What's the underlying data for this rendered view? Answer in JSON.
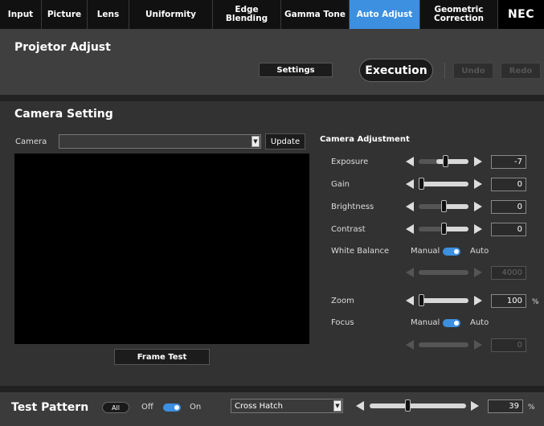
{
  "tabs": [
    {
      "label": "Input"
    },
    {
      "label": "Picture"
    },
    {
      "label": "Lens"
    },
    {
      "label": "Uniformity"
    },
    {
      "label": "Edge Blending"
    },
    {
      "label": "Gamma Tone"
    },
    {
      "label": "Auto Adjust"
    },
    {
      "label": "Geometric Correction"
    },
    {
      "label": "NEC"
    }
  ],
  "active_tab": "Auto Adjust",
  "projector": {
    "title": "Projetor Adjust",
    "settings_label": "Settings",
    "execution_label": "Execution",
    "undo_label": "Undo",
    "redo_label": "Redo"
  },
  "camera": {
    "title": "Camera Setting",
    "camera_label": "Camera",
    "camera_value": "",
    "update_label": "Update",
    "frame_test_label": "Frame Test"
  },
  "adjust": {
    "title": "Camera Adjustment",
    "exposure": {
      "label": "Exposure",
      "value": "-7",
      "level": 0.55
    },
    "gain": {
      "label": "Gain",
      "value": "0",
      "level": 0.0
    },
    "brightness": {
      "label": "Brightness",
      "value": "0",
      "level": 0.5
    },
    "contrast": {
      "label": "Contrast",
      "value": "0",
      "level": 0.5
    },
    "white_balance": {
      "label": "White Balance",
      "manual": "Manual",
      "auto": "Auto",
      "value": "4000"
    },
    "zoom": {
      "label": "Zoom",
      "value": "100",
      "unit": "%",
      "level": 0.0
    },
    "focus": {
      "label": "Focus",
      "manual": "Manual",
      "auto": "Auto",
      "value": "0"
    }
  },
  "test_pattern": {
    "title": "Test Pattern",
    "all_label": "All",
    "off_label": "Off",
    "on_label": "On",
    "pattern_value": "Cross Hatch",
    "value": "39",
    "unit": "%",
    "level": 0.39
  },
  "colors": {
    "accent": "#3d8fe0"
  }
}
